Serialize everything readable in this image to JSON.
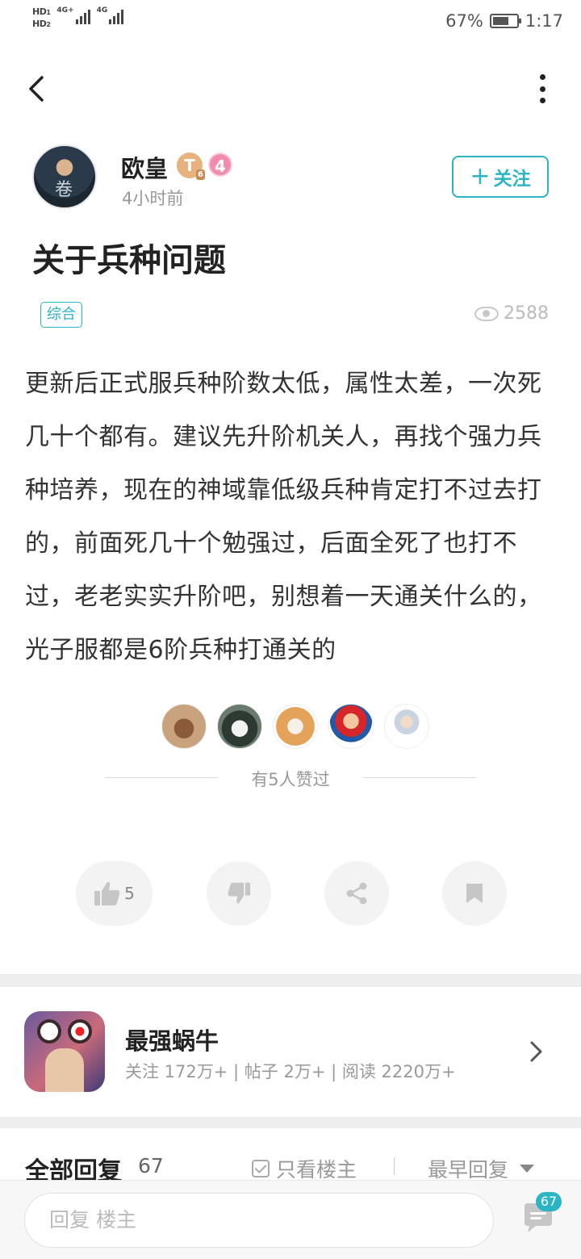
{
  "status_bar": {
    "sim1": "HD",
    "sim1_no": "1",
    "sim2": "HD",
    "sim2_no": "2",
    "net1": "4G+",
    "net2": "4G",
    "battery": "67%",
    "battery_level": 0.67,
    "time": "1:17"
  },
  "author": {
    "name": "欧皇",
    "badge_t": "T",
    "badge_t_level": "6",
    "level": "4",
    "time_ago": "4小时前",
    "avatar_glyph": "卷",
    "follow_label": "关注"
  },
  "post": {
    "title": "关于兵种问题",
    "tag": "综合",
    "views": "2588",
    "body": "更新后正式服兵种阶数太低，属性太差，一次死几十个都有。建议先升阶机关人，再找个强力兵种培养，现在的神域靠低级兵种肯定打不过去打的，前面死几十个勉强过，后面全死了也打不过，老老实实升阶吧，别想着一天通关什么的，光子服都是6阶兵种打通关的",
    "likes_text": "有5人赞过",
    "like_count": "5"
  },
  "forum": {
    "name": "最强蜗牛",
    "stats": "关注 172万+ | 帖子 2万+ | 阅读 2220万+"
  },
  "replies": {
    "title": "全部回复",
    "count": "67",
    "only_op": "只看楼主",
    "sort": "最早回复"
  },
  "bottom": {
    "placeholder": "回复  楼主",
    "comment_badge": "67"
  },
  "icons": {
    "back": "chevron-left-icon",
    "more": "more-vertical-icon",
    "eye": "eye-icon",
    "like": "thumbs-up-icon",
    "dislike": "thumbs-down-icon",
    "share": "share-icon",
    "bookmark": "bookmark-icon",
    "chevron": "chevron-right-icon",
    "comment": "comment-icon"
  },
  "colors": {
    "accent": "#2bb5c4",
    "badge_t": "#e8b27e",
    "badge_level": "#f28cae"
  }
}
